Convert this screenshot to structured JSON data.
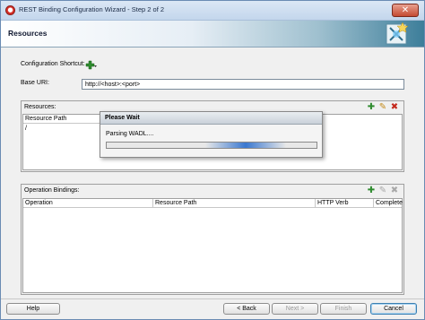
{
  "window": {
    "title": "REST Binding Configuration Wizard - Step 2 of 2"
  },
  "header": {
    "title": "Resources"
  },
  "config_shortcut": {
    "label": "Configuration Shortcut:"
  },
  "base_uri": {
    "label": "Base URI:",
    "value": "http://<host>:<port>"
  },
  "resources": {
    "label": "Resources:",
    "columns": [
      "Resource Path"
    ],
    "rows": [
      "/"
    ]
  },
  "operation_bindings": {
    "label": "Operation Bindings:",
    "columns": [
      "Operation",
      "Resource Path",
      "HTTP Verb",
      "Complete"
    ]
  },
  "dialog": {
    "title": "Please Wait",
    "message": "Parsing WADL....",
    "progress_indeterminate": true
  },
  "buttons": {
    "help": "Help",
    "back": "< Back",
    "next": "Next >",
    "finish": "Finish",
    "cancel": "Cancel"
  },
  "icons": {
    "title": "app-icon",
    "add": "add-icon",
    "edit": "edit-icon",
    "delete": "delete-icon",
    "close": "close-icon"
  },
  "colors": {
    "add": "#2e8b2e",
    "edit": "#c48a1a",
    "delete": "#c4281c",
    "progress": "#3a78d0"
  }
}
